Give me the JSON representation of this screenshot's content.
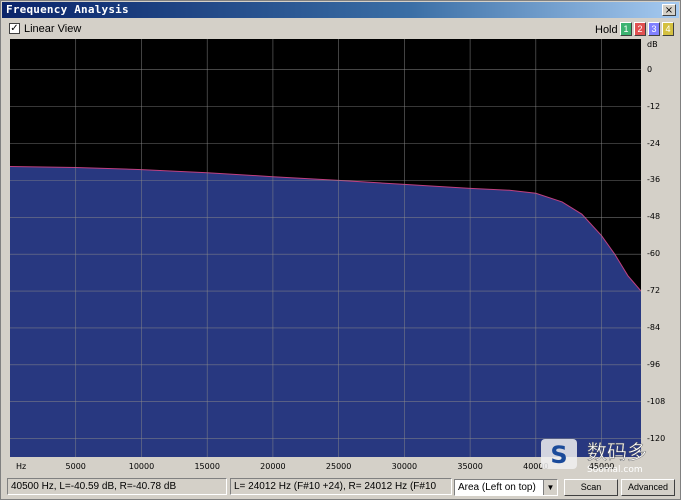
{
  "window": {
    "title": "Frequency Analysis",
    "close_glyph": "×"
  },
  "toolbar": {
    "linear_view_label": "Linear View",
    "linear_view_checked": true,
    "hold_label": "Hold",
    "hold_buttons": [
      {
        "label": "1",
        "color": "#3cb371"
      },
      {
        "label": "2",
        "color": "#e05050"
      },
      {
        "label": "3",
        "color": "#8080ff"
      },
      {
        "label": "4",
        "color": "#d4c040"
      }
    ]
  },
  "chart_data": {
    "type": "area",
    "xlabel": "Hz",
    "ylabel": "dB",
    "xlim": [
      0,
      48000
    ],
    "ylim": [
      -126,
      10
    ],
    "x_ticks": [
      5000,
      10000,
      15000,
      20000,
      25000,
      30000,
      35000,
      40000,
      45000
    ],
    "x_tick_labels": [
      "5000",
      "10000",
      "15000",
      "20000",
      "25000",
      "30000",
      "35000",
      "40000",
      "45000"
    ],
    "y_ticks": [
      0,
      -12,
      -24,
      -36,
      -48,
      -60,
      -72,
      -84,
      -96,
      -108,
      -120
    ],
    "y_tick_labels": [
      "0",
      "-12",
      "-24",
      "-36",
      "-48",
      "-60",
      "-72",
      "-84",
      "-96",
      "-108",
      "-120"
    ],
    "grid": true,
    "fill_color": "#283880",
    "line_color": "#c04080",
    "x": [
      0,
      5000,
      10000,
      15000,
      20000,
      25000,
      30000,
      35000,
      38000,
      40000,
      42000,
      43500,
      45000,
      46000,
      47000,
      48000
    ],
    "y": [
      -31.5,
      -31.8,
      -32.5,
      -33.5,
      -34.8,
      -36,
      -37.3,
      -38.6,
      -39.2,
      -40.2,
      -43,
      -47,
      -54,
      -60,
      -67,
      -72
    ]
  },
  "status": {
    "cursor": "40500 Hz, L=-40.59 dB, R=-40.78 dB",
    "peak": "L=  24012 Hz (F#10 +24), R=  24012 Hz (F#10",
    "view_mode": "Area (Left on top)",
    "dropdown_glyph": "▼",
    "scan_label": "Scan",
    "advanced_label": "Advanced"
  },
  "watermark": {
    "text": "数码多",
    "sub": "Soomal.com",
    "logo_letter": "S"
  }
}
